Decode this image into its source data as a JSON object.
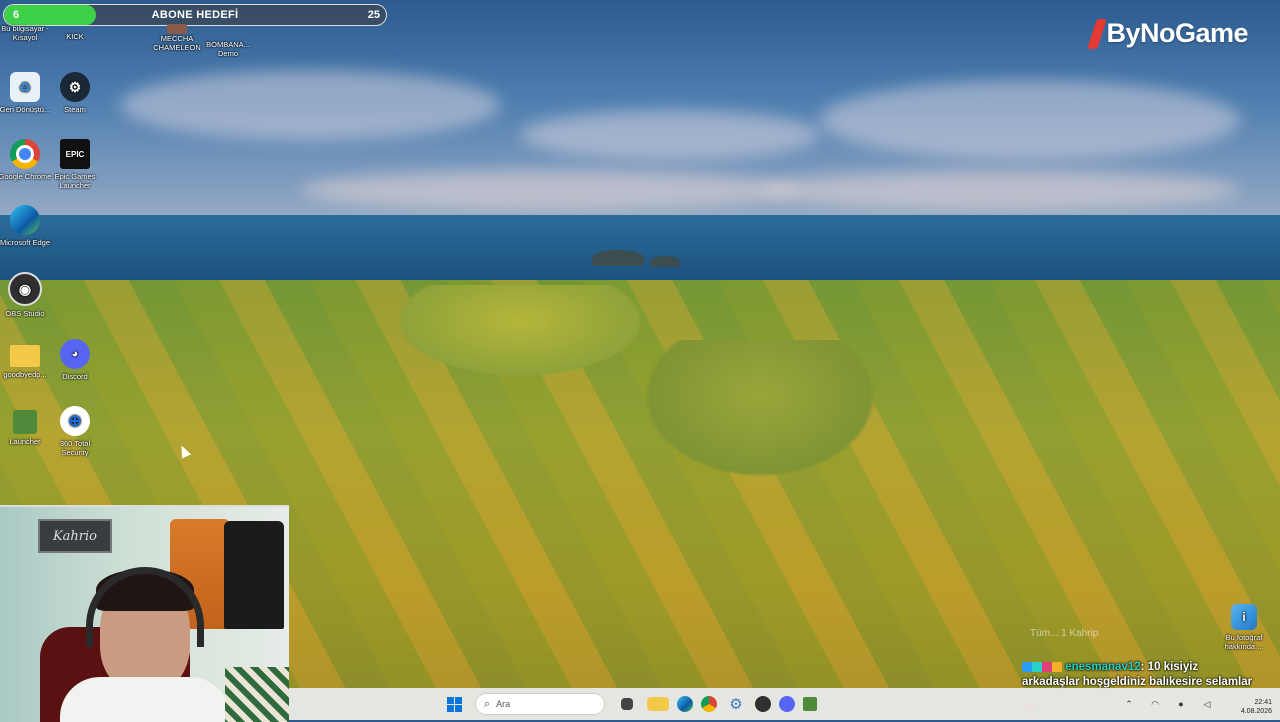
{
  "subscriber_goal": {
    "current": "6",
    "title": "ABONE HEDEFİ",
    "target": "25",
    "progress": 0.24
  },
  "desktop_icons": [
    {
      "label": "Bu bilgisayar - Kısayol",
      "icon": "computer-icon"
    },
    {
      "label": "KICK",
      "icon": "kick-icon"
    },
    {
      "label": "MECCHA CHAMELEON",
      "icon": "game-icon"
    },
    {
      "label": "BOMBANA... Demo",
      "icon": "game-icon"
    },
    {
      "label": "Geri Dönüştü...",
      "icon": "recycle-bin-icon"
    },
    {
      "label": "Steam",
      "icon": "steam-icon"
    },
    {
      "label": "Google Chrome",
      "icon": "chrome-icon"
    },
    {
      "label": "Epic Games Launcher",
      "icon": "epic-games-icon"
    },
    {
      "label": "Microsoft Edge",
      "icon": "edge-icon"
    },
    {
      "label": "OBS Studio",
      "icon": "obs-icon"
    },
    {
      "label": "goodbyedp...",
      "icon": "folder-icon"
    },
    {
      "label": "Discord",
      "icon": "discord-icon"
    },
    {
      "label": "Launcher",
      "icon": "minecraft-launcher-icon"
    },
    {
      "label": "360 Total Security",
      "icon": "security-icon"
    }
  ],
  "logo": {
    "text": "ByNoGame"
  },
  "webcam": {
    "sign_text": "Kahrio"
  },
  "spotlight": {
    "label": "Bu fotoğraf hakkında ..."
  },
  "chat": {
    "ghost_text": "Tüm... 1 Kahrip",
    "username": "enesmanav12",
    "message_part1": ": 10 kisiyiz",
    "message_part2": "arkadaşlar hoşgeldiniz balıkesire selamlar"
  },
  "taskbar": {
    "search_placeholder": "Ara",
    "icons": [
      "windows-start-icon",
      "search-icon",
      "widget-icon",
      "task-view-icon",
      "file-explorer-icon",
      "edge-icon",
      "chrome-icon",
      "settings-icon",
      "obs-icon",
      "discord-icon",
      "minecraft-icon"
    ],
    "time": "22:41",
    "date": "4.08.2026"
  },
  "colors": {
    "goal_fill": "#3fd04a",
    "chat_user": "#27d0c8",
    "logo_accent": "#e53935"
  }
}
